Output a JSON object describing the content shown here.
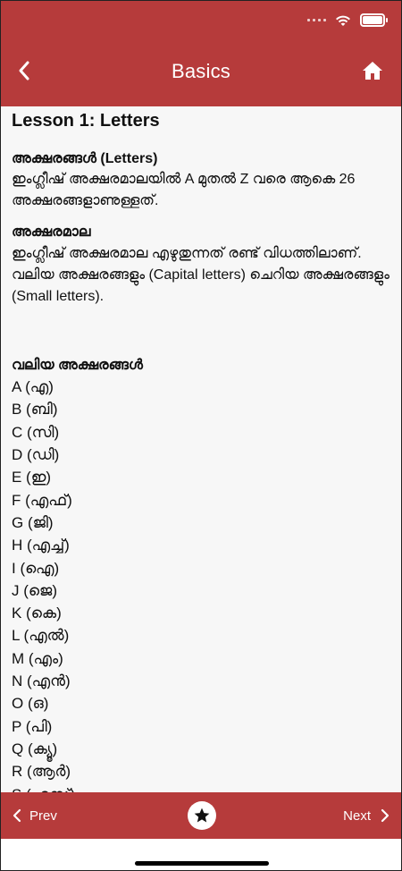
{
  "header": {
    "title": "Basics",
    "color": "#b63b3b"
  },
  "icons": {
    "back": "chevron-left-icon",
    "home": "home-icon",
    "favorite": "star-icon",
    "prev": "chevron-left-icon",
    "next": "chevron-right-icon"
  },
  "content": {
    "lesson_title": "Lesson 1: Letters",
    "sections": [
      {
        "title": "അക്ഷരങ്ങൾ (Letters)",
        "text": "ഇംഗ്ലീഷ് അക്ഷരമാലയിൽ A മുതൽ Z വരെ ആകെ 26 അക്ഷരങ്ങളാണുള്ളത്."
      },
      {
        "title": "അക്ഷരമാല",
        "text": "ഇംഗ്ലീഷ് അക്ഷരമാല എഴുതുന്നത് രണ്ട് വിധത്തിലാണ്. വലിയ അക്ഷരങ്ങളും (Capital letters) ചെറിയ അക്ഷരങ്ങളും (Small letters)."
      }
    ],
    "capital_title": "വലിയ അക്ഷരങ്ങൾ",
    "letters": [
      "A (എ)",
      "B (ബി)",
      "C (സി)",
      "D (ഡി)",
      "E (ഇ)",
      "F (എഫ്)",
      "G (ജി)",
      "H (എച്ച്)",
      "I (ഐ)",
      "J (ജെ)",
      "K (കെ)",
      "L (എൽ)",
      "M (എം)",
      "N (എൻ)",
      "O (ഒ)",
      "P (പി)",
      "Q (ക്യൂ)",
      "R (ആർ)",
      "S (എസ്)"
    ]
  },
  "footer": {
    "prev_label": "Prev",
    "next_label": "Next"
  }
}
